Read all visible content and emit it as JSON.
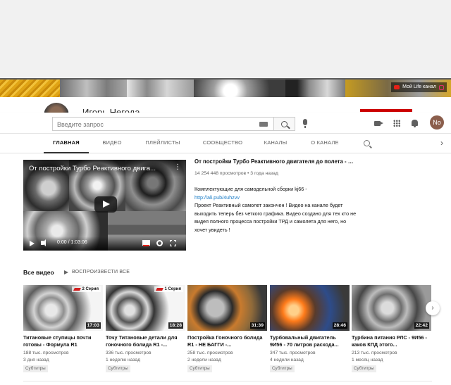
{
  "banner": {
    "links": "Мой Life канал"
  },
  "channel": {
    "name": "Игорь Негода"
  },
  "masthead": {
    "search_placeholder": "Введите запрос",
    "avatar_initials": "No"
  },
  "tabs": [
    {
      "label": "ГЛАВНАЯ",
      "active": true
    },
    {
      "label": "ВИДЕО"
    },
    {
      "label": "ПЛЕЙЛИСТЫ"
    },
    {
      "label": "СООБЩЕСТВО"
    },
    {
      "label": "КАНАЛЫ"
    },
    {
      "label": "О КАНАЛЕ"
    }
  ],
  "featured": {
    "player_title": "От постройки Турбо Реактивного двига...",
    "time": "0:00 / 1:03:06",
    "title": "От постройки Турбо Реактивного двигателя до полета - вс...",
    "meta": "14 254 448 просмотров • 3 года назад",
    "desc_line1": "Комплектующие для самодельной сборки kj66 -",
    "desc_link": "http://ali.pub/4uhzvv",
    "desc_rest": "Проект Реактивный самолет закончен ! Видео на канале будет выходить теперь без четкого графика. Видео создано для тех кто не видел полного процесса постройки ТРД и самолета для него, но хочет увидеть !"
  },
  "section": {
    "title": "Все видео",
    "play_all": "ВОСПРОИЗВЕСТИ ВСЕ"
  },
  "videos": [
    {
      "title": "Титановые ступицы почти готовы - Формула R1",
      "views": "188 тыс. просмотров",
      "age": "3 дня назад",
      "duration": "17:03",
      "series": "2 Серия",
      "badge": "Субтитры"
    },
    {
      "title": "Точу Титановые детали для гоночного болида R1 -...",
      "views": "336 тыс. просмотров",
      "age": "1 неделю назад",
      "duration": "18:28",
      "series": "1 Серия",
      "badge": "Субтитры"
    },
    {
      "title": "Постройка Гоночного болида R1 - НЕ БАГГИ -...",
      "views": "258 тыс. просмотров",
      "age": "2 недели назад",
      "duration": "31:39",
      "badge": "Субтитры"
    },
    {
      "title": "Турбовальный двигатель 9И56 - 70 литров расхода...",
      "views": "347 тыс. просмотров",
      "age": "4 недели назад",
      "duration": "28:46",
      "badge": "Субтитры"
    },
    {
      "title": "Турбина питания РЛС - 9И56 - каков КПД этого...",
      "views": "213 тыс. просмотров",
      "age": "1 месяц назад",
      "duration": "22:42",
      "badge": "Субтитры"
    }
  ]
}
